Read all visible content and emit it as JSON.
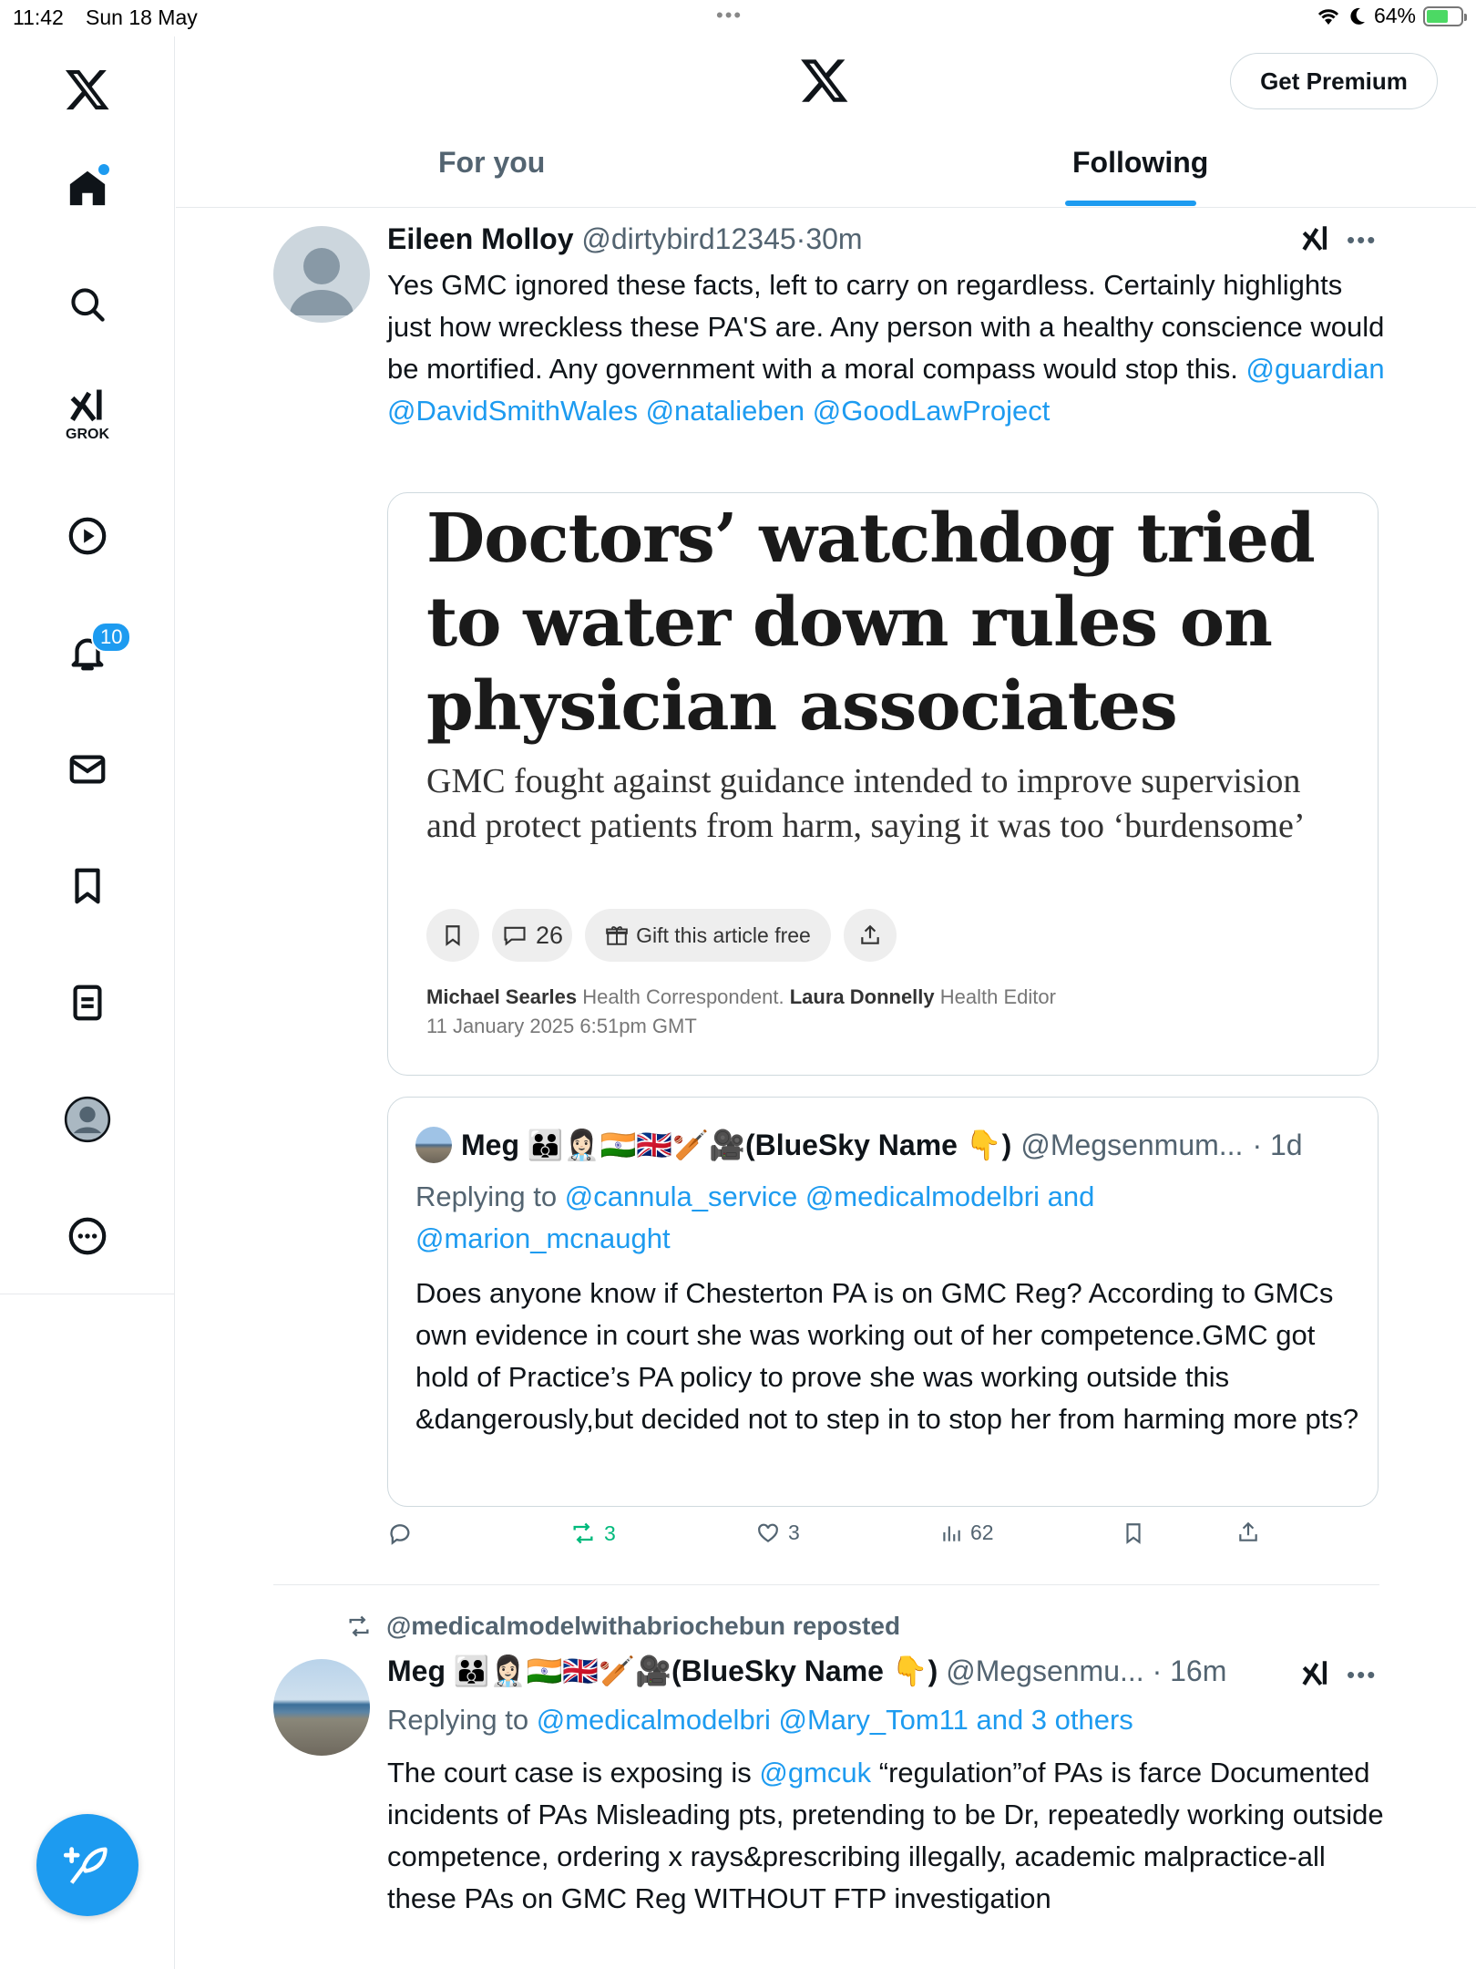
{
  "status_bar": {
    "time": "11:42",
    "date": "Sun 18 May",
    "battery": "64%",
    "battery_level": 0.64
  },
  "sidebar": {
    "grok_label": "GROK",
    "notifications_count": "10"
  },
  "header": {
    "premium_label": "Get Premium",
    "tabs": [
      {
        "label": "For you",
        "active": false
      },
      {
        "label": "Following",
        "active": true
      }
    ]
  },
  "tweet1": {
    "name": "Eileen Molloy",
    "handle": "@dirtybird12345",
    "sep": "·",
    "time": "30m",
    "text": "Yes GMC ignored these facts, left to carry on regardless. Certainly highlights just how wreckless these PA'S are. Any person with a healthy conscience would be mortified. Any government with a moral compass would stop this.",
    "mentions": [
      "@guardian",
      "@DavidSmithWales",
      "@natalieben",
      "@GoodLawProject"
    ],
    "card": {
      "headline": "Doctors’ watchdog tried to water down rules on physician associates",
      "subheadline": "GMC fought against guidance intended to improve supervision and protect patients from harm, saying it was too ‘burdensome’",
      "comments": "26",
      "gift_label": "Gift this article free",
      "author1": "Michael Searles",
      "author1_role": "Health Correspondent.",
      "author2": "Laura Donnelly",
      "author2_role": "Health Editor",
      "date": "11 January 2025 6:51pm GMT"
    },
    "quote": {
      "name": "Meg 👪👩🏻‍⚕️🇮🇳🇬🇧🏏🎥(BlueSky Name 👇)",
      "handle": "@Megsenmum...",
      "time": "· 1d",
      "replying_prefix": "Replying to",
      "replying_to": "@cannula_service @medicalmodelbri and",
      "replying_to2": "@marion_mcnaught",
      "text": "Does anyone know if Chesterton PA is on GMC Reg? According to GMCs own evidence in court she was working out of her competence.GMC got hold of Practice’s PA policy to prove she was working outside this &dangerously,but decided not to step in to stop her from harming more pts?"
    },
    "actions": {
      "reposts": "3",
      "likes": "3",
      "views": "62"
    }
  },
  "tweet2": {
    "repost_label": "@medicalmodelwithabriochebun reposted",
    "name": "Meg 👪👩🏻‍⚕️🇮🇳🇬🇧🏏🎥(BlueSky Name 👇)",
    "handle": "@Megsenmu...",
    "time": "· 16m",
    "replying_prefix": "Replying to",
    "replying_to": "@medicalmodelbri @Mary_Tom11 and 3 others",
    "text_prefix": "The court case is exposing is",
    "text_mention": "@gmcuk",
    "text_rest": "“regulation”of PAs is farce Documented incidents of PAs Misleading pts, pretending to be Dr, repeatedly working outside competence, ordering x rays&prescribing illegally, academic malpractice-all these PAs on GMC Reg WITHOUT FTP investigation"
  },
  "colors": {
    "accent": "#1d9bf0",
    "repost_green": "#00ba7c",
    "muted": "#536471"
  }
}
